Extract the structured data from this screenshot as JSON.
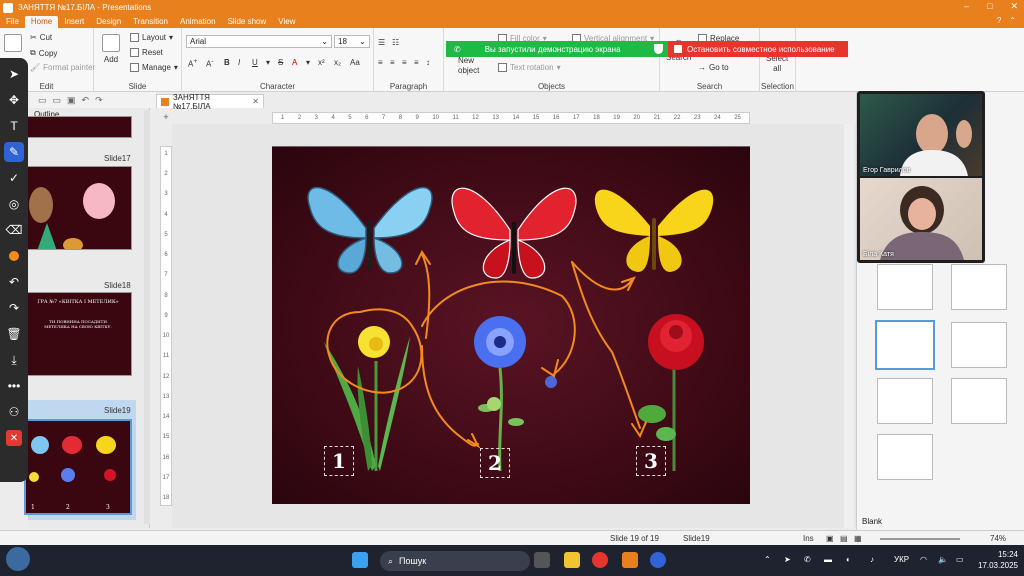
{
  "window": {
    "title": "ЗАНЯТТЯ №17.БІЛА - Presentations"
  },
  "menu": [
    "File",
    "Home",
    "Insert",
    "Design",
    "Transition",
    "Animation",
    "Slide show",
    "View"
  ],
  "ribbon": {
    "edit": {
      "cut": "Cut",
      "copy": "Copy",
      "format_painter": "Format painter",
      "label": "Edit"
    },
    "slide": {
      "add": "Add",
      "layout": "Layout",
      "reset": "Reset",
      "manage": "Manage",
      "label": "Slide"
    },
    "character": {
      "font": "Arial",
      "size": "18",
      "label": "Character"
    },
    "paragraph": {
      "label": "Paragraph"
    },
    "objects": {
      "new_object_1": "New",
      "new_object_2": "object",
      "fill_color": "Fill color",
      "vertical_alignment": "Vertical alignment",
      "text_rotation": "Text rotation",
      "label": "Objects"
    },
    "search": {
      "search": "Search",
      "replace": "Replace",
      "goto": "Go to",
      "label": "Search"
    },
    "selection": {
      "select_1": "Select",
      "select_2": "all",
      "label": "Selection"
    }
  },
  "share": {
    "green_text": "Вы запустили демонстрацию экрана",
    "red_text": "Остановить совместное использование"
  },
  "doc_tab": "ЗАНЯТТЯ №17.БІЛА",
  "slide_panel": {
    "outline": "Outline",
    "slides": [
      {
        "label": "Slide17"
      },
      {
        "label": "Slide18",
        "text_1": "ГРА №7 «КВІТКА І МЕТЕЛИК»",
        "text_2": "ТИ ПОВИННА ПОСАДИТИ МЕТЕЛИКА НА СВОЮ КВІТКУ."
      },
      {
        "label": "Slide19"
      }
    ]
  },
  "ruler": [
    "1",
    "2",
    "3",
    "4",
    "5",
    "6",
    "7",
    "8",
    "9",
    "10",
    "11",
    "12",
    "13",
    "14",
    "15",
    "16",
    "17",
    "18",
    "19",
    "20",
    "21",
    "22",
    "23",
    "24",
    "25"
  ],
  "vruler": [
    "1",
    "2",
    "3",
    "4",
    "5",
    "6",
    "7",
    "8",
    "9",
    "10",
    "11",
    "12",
    "13",
    "14",
    "15",
    "16",
    "17",
    "18"
  ],
  "slide": {
    "numbers": [
      "1",
      "2",
      "3"
    ]
  },
  "participants": [
    {
      "name": "Егор Гаврилов"
    },
    {
      "name": "Біла Катя"
    }
  ],
  "right_panel": {
    "selected_layout": "Blank"
  },
  "status": {
    "page": "Slide 19 of 19",
    "name": "Slide19",
    "mode": "Ins",
    "zoom": "74%"
  },
  "taskbar": {
    "search": "Пошук",
    "lang": "УКР",
    "time": "15:24",
    "date": "17.03.2025"
  },
  "colors": {
    "accent": "#e8801e",
    "slide_bg": "#3f0a16",
    "annotation": "#f28b1e"
  }
}
